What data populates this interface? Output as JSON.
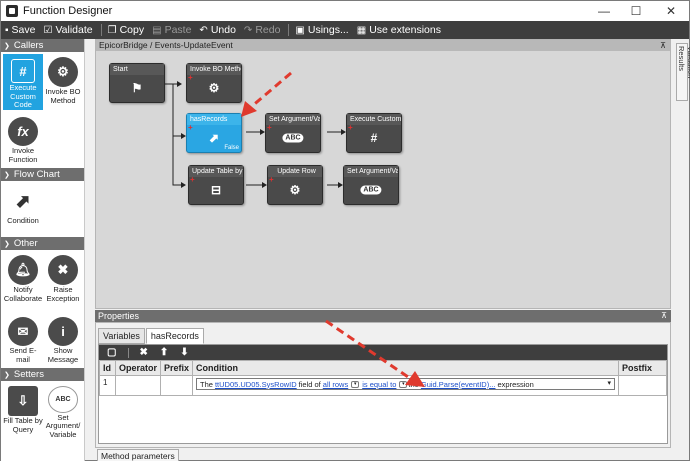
{
  "window": {
    "title": "Function Designer"
  },
  "toolbar": {
    "items": [
      {
        "label": "Save",
        "icon": "save-icon"
      },
      {
        "label": "Validate",
        "icon": "validate-icon"
      },
      {
        "label": "Copy",
        "icon": "copy-icon"
      },
      {
        "label": "Paste",
        "icon": "paste-icon",
        "disabled": true
      },
      {
        "label": "Undo",
        "icon": "undo-icon"
      },
      {
        "label": "Redo",
        "icon": "redo-icon",
        "disabled": true
      },
      {
        "label": "Usings...",
        "icon": "usings-icon"
      },
      {
        "label": "Use extensions",
        "icon": "extensions-icon"
      }
    ]
  },
  "sidebar": {
    "sections": [
      {
        "title": "Callers",
        "tools": [
          {
            "label": "Execute Custom Code",
            "icon": "hash-icon",
            "active": true
          },
          {
            "label": "Invoke BO Method",
            "icon": "invoke-bo-icon"
          },
          {
            "label": "Invoke Function",
            "icon": "function-icon"
          }
        ]
      },
      {
        "title": "Flow Chart",
        "tools": [
          {
            "label": "Condition",
            "icon": "condition-icon"
          }
        ]
      },
      {
        "title": "Other",
        "tools": [
          {
            "label": "Notify Collaborate",
            "icon": "bell-icon"
          },
          {
            "label": "Raise Exception",
            "icon": "exception-icon"
          },
          {
            "label": "Send E-mail",
            "icon": "mail-icon"
          },
          {
            "label": "Show Message",
            "icon": "info-icon"
          }
        ]
      },
      {
        "title": "Setters",
        "tools": [
          {
            "label": "Fill Table by Query",
            "icon": "fill-table-icon"
          },
          {
            "label": "Set Argument/ Variable",
            "icon": "abc-icon"
          }
        ]
      }
    ]
  },
  "designer": {
    "breadcrumb": "EpicorBridge / Events-UpdateEvent",
    "nodes": [
      {
        "id": "start",
        "title": "Start",
        "icon": "flag-icon"
      },
      {
        "id": "invoke",
        "title": "Invoke BO Method",
        "icon": "invoke-bo-icon"
      },
      {
        "id": "hasrecords",
        "title": "hasRecords",
        "icon": "condition-icon",
        "selected": true,
        "tag": "False"
      },
      {
        "id": "setarg1",
        "title": "Set Argument/Vari",
        "icon": "abc-icon"
      },
      {
        "id": "execcode",
        "title": "Execute Custom Co",
        "icon": "hash-icon"
      },
      {
        "id": "updtable",
        "title": "Update Table by Q",
        "icon": "update-table-icon"
      },
      {
        "id": "updrow",
        "title": "Update Row",
        "icon": "invoke-bo-icon"
      },
      {
        "id": "setarg2",
        "title": "Set Argument/Vari",
        "icon": "abc-icon"
      }
    ],
    "vertical_tab": "Validation Results"
  },
  "properties": {
    "header": "Properties",
    "tabs": [
      "Variables",
      "hasRecords"
    ],
    "columns": [
      "Id",
      "Operator",
      "Prefix",
      "Condition",
      "Postfix"
    ],
    "row": {
      "id": "1",
      "operator": "",
      "prefix": "",
      "postfix": "",
      "condition": {
        "t1": "The",
        "field": "ttUD05.UD05.SysRowID",
        "t2": "field of",
        "rows": "all rows",
        "op": "is equal to",
        "t3": "the",
        "expr": "Guid.Parse(eventID)...",
        "t4": "expression"
      }
    }
  },
  "bottom_tab": "Method parameters",
  "colors": {
    "accent": "#22a3e0",
    "toolbar": "#3e3e3e",
    "arrow": "#e03a2e"
  }
}
